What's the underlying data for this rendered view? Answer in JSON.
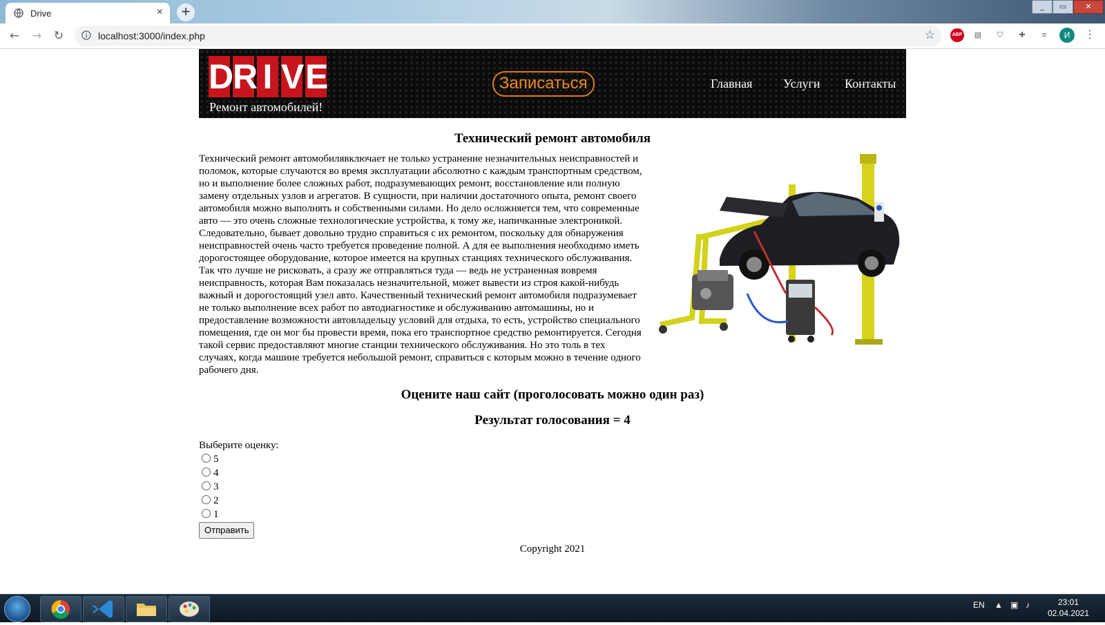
{
  "browser": {
    "tab_title": "Drive",
    "tab_close": "×",
    "new_tab": "+",
    "url": "localhost:3000/index.php",
    "avatar_letter": "И",
    "abp_label": "ABP"
  },
  "header": {
    "logo_letters": [
      "D",
      "R",
      "I",
      "V",
      "E"
    ],
    "slogan": "Ремонт автомобилей!",
    "signup_label": "Записаться",
    "nav": [
      "Главная",
      "Услуги",
      "Контакты"
    ]
  },
  "main": {
    "title": "Технический ремонт автомобиля",
    "article": "Технический ремонт автомобилявключает не только устранение незначительных неисправностей и поломок, которые случаются во время эксплуатации абсолютно с каждым транспортным средством, но и выполнение более сложных работ, подразумевающих ремонт, восстановление или полную замену отдельных узлов и агрегатов. В сущности, при наличии достаточного опыта, ремонт своего автомобиля можно выполнять и собственными силами. Но дело осложняется тем, что современные авто — это очень сложные технологические устройства, к тому же, напичканные электроникой. Следовательно, бывает довольно трудно справиться с их ремонтом, поскольку для обнаружения неисправностей очень часто требуется проведение полной. А для ее выполнения необходимо иметь дорогостоящее оборудование, которое имеется на крупных станциях технического обслуживания. Так что лучше не рисковать, а сразу же отправляться туда — ведь не устраненная вовремя неисправность, которая Вам показалась незначительной, может вывести из строя какой-нибудь важный и дорогостоящий узел авто. Качественный технический ремонт автомобиля подразумевает не только выполнение всех работ по автодиагностике и обслуживанию автомашины, но и предоставление возможности автовладельцу условий для отдыха, то есть, устройство специального помещения, где он мог бы провести время, пока его транспортное средство ремонтируется. Сегодня такой сервис предоставляют многие станции технического обслуживания. Но это толь в тех случаях, когда машине требуется небольшой ремонт, справиться с которым можно в течение одного рабочего дня."
  },
  "vote": {
    "title": "Оцените наш сайт (проголосовать можно один раз)",
    "result": "Результат голосования = 4",
    "prompt": "Выберите оценку:",
    "options": [
      "5",
      "4",
      "3",
      "2",
      "1"
    ],
    "submit_label": "Отправить"
  },
  "footer": {
    "copyright": "Copyright 2021"
  },
  "taskbar": {
    "lang": "EN",
    "time": "23:01",
    "date": "02.04.2021"
  }
}
